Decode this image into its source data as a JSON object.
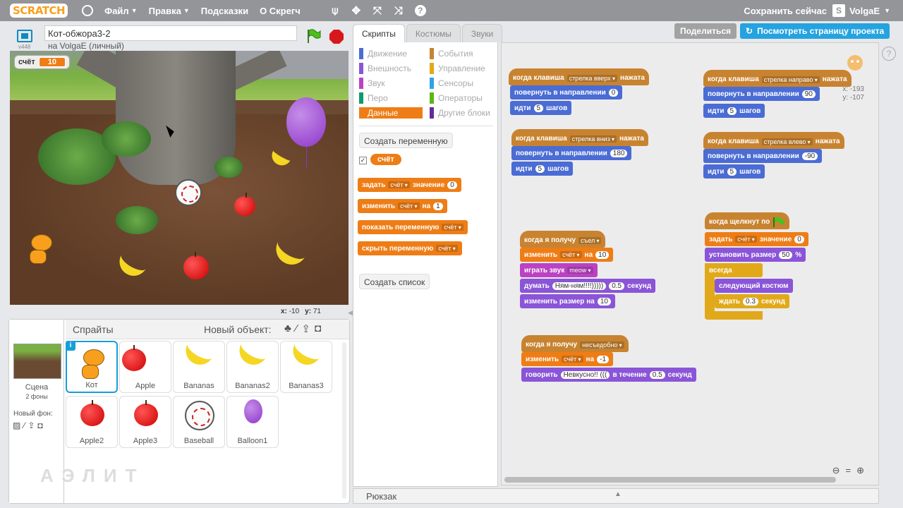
{
  "menubar": {
    "logo": "SCRATCH",
    "file": "Файл",
    "edit": "Правка",
    "tips": "Подсказки",
    "about": "О Скрегч",
    "save_now": "Сохранить сейчас",
    "user": "VolgaE"
  },
  "stage": {
    "version": "v448",
    "project_title": "Кот-обжора3-2",
    "owner": "на VolgaE (личный)",
    "var_name": "счёт",
    "var_value": "10",
    "x_label": "x:",
    "x_value": "-10",
    "y_label": "y:",
    "y_value": "71"
  },
  "sprites_panel": {
    "title": "Спрайты",
    "new_object": "Новый объект:",
    "scene_label": "Сцена",
    "scene_sub": "2 фоны",
    "new_bg": "Новый фон:",
    "watermark": "АЭЛИТ",
    "items": [
      "Кот",
      "Apple",
      "Bananas",
      "Bananas2",
      "Bananas3",
      "Apple2",
      "Apple3",
      "Baseball",
      "Balloon1"
    ]
  },
  "tabs": [
    "Скрипты",
    "Костюмы",
    "Звуки"
  ],
  "share": "Поделиться",
  "see_project": "Посмотреть страницу проекта",
  "categories": {
    "motion": "Движение",
    "events": "События",
    "looks": "Внешность",
    "control": "Управление",
    "sound": "Звук",
    "sensing": "Сенсоры",
    "pen": "Перо",
    "operators": "Операторы",
    "data": "Данные",
    "more": "Другие блоки"
  },
  "palette": {
    "make_var": "Создать переменную",
    "var_reporter": "счёт",
    "set_block": "задать",
    "set_to": "значение",
    "set_val": "0",
    "change_block": "изменить",
    "change_by": "на",
    "change_val": "1",
    "show_block": "показать переменную",
    "hide_block": "скрыть переменную",
    "make_list": "Создать список"
  },
  "scripts": {
    "when_key": "когда клавиша",
    "pressed": "нажата",
    "up_arrow": "стрелка вверх",
    "down_arrow": "стрелка вниз",
    "right_arrow": "стрелка направо",
    "left_arrow": "стрелка влево",
    "point_dir": "повернуть в направлении",
    "move": "идти",
    "steps": "шагов",
    "dir_up": "0",
    "dir_down": "180",
    "dir_right": "90",
    "dir_left": "-90",
    "step_val": "5",
    "when_receive": "когда я получу",
    "msg_eaten": "съел",
    "msg_inedible": "несъедобно",
    "change": "изменить",
    "var": "счёт",
    "by": "на",
    "val_10": "10",
    "val_neg1": "-1",
    "play_sound": "играть звук",
    "sound_meow": "meow",
    "think": "думать",
    "think_text": "Ням-ням!!!!)))))",
    "secs": "секунд",
    "think_secs": "0.5",
    "change_size": "изменить размер на",
    "size_10": "10",
    "say": "говорить",
    "say_text": "Невкусно!! (((",
    "for_dur": "в течение",
    "say_secs": "0.5",
    "flag_clicked": "когда щелкнут по",
    "set": "задать",
    "to_value": "значение",
    "set_zero": "0",
    "set_size": "установить размер",
    "size_50": "50",
    "percent": "%",
    "forever": "всегда",
    "next_costume": "следующий костюм",
    "wait": "ждать",
    "wait_val": "0.3",
    "sec": "секунд",
    "pos_x": "x: -193",
    "pos_y": "y: -107"
  },
  "backpack": "Рюкзак"
}
